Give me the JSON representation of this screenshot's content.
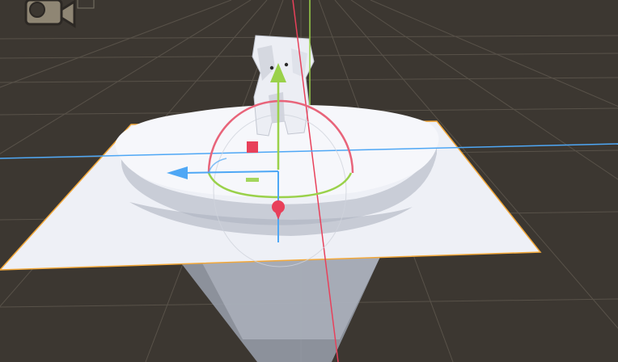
{
  "view": {
    "name": "Scene View",
    "background_color": "#3c3731",
    "grid_color": "#5a544b"
  },
  "gizmos": {
    "camera_icon": "camera-icon",
    "x_axis_color": "#e8405a",
    "y_axis_color": "#9ad14a",
    "z_axis_color": "#4ea7f5",
    "rotate_ring_color": "#e8647a",
    "plane_outline_color": "#f2a83a"
  },
  "objects": [
    {
      "name": "plane",
      "color": "#eef0f6"
    },
    {
      "name": "ice-floe",
      "color": "#f5f6fa"
    },
    {
      "name": "polar-bear",
      "color": "#eceef4"
    },
    {
      "name": "camera-frustum",
      "color": "#a3a9b6"
    }
  ]
}
